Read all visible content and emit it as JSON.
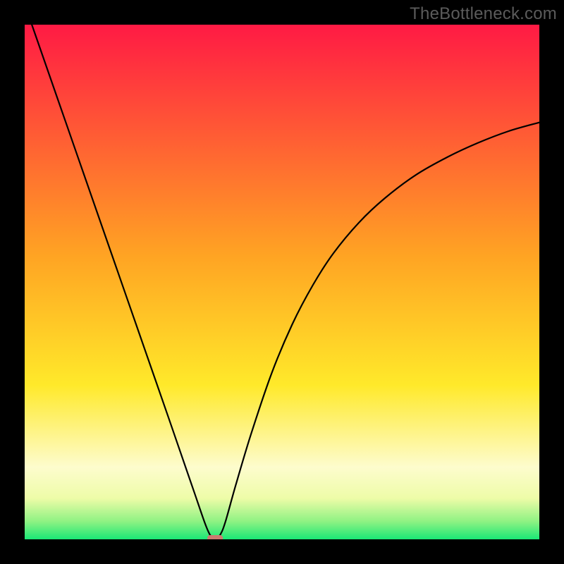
{
  "watermark": "TheBottleneck.com",
  "chart_data": {
    "type": "line",
    "title": "",
    "xlabel": "",
    "ylabel": "",
    "xlim": [
      0,
      100
    ],
    "ylim": [
      0,
      100
    ],
    "grid": false,
    "legend": false,
    "marker": {
      "x": 37,
      "y": 0,
      "color": "#cc7a70"
    },
    "gradient_stops": [
      {
        "offset": 0.0,
        "color": "#ff1a44"
      },
      {
        "offset": 0.45,
        "color": "#ffa423"
      },
      {
        "offset": 0.7,
        "color": "#ffe92a"
      },
      {
        "offset": 0.86,
        "color": "#fdfccd"
      },
      {
        "offset": 0.92,
        "color": "#eefca8"
      },
      {
        "offset": 0.965,
        "color": "#8ff283"
      },
      {
        "offset": 1.0,
        "color": "#1ae876"
      }
    ],
    "series": [
      {
        "name": "bottleneck-curve",
        "x": [
          0,
          4,
          8,
          12,
          16,
          20,
          24,
          28,
          31,
          33,
          35,
          36,
          37,
          38,
          39,
          41,
          44,
          48,
          52,
          56,
          60,
          65,
          70,
          76,
          82,
          88,
          94,
          100
        ],
        "y": [
          104,
          92.5,
          81,
          69.5,
          58,
          46.5,
          35,
          23.5,
          14.8,
          9.0,
          3.2,
          0.9,
          0.0,
          0.9,
          3.4,
          10.5,
          20.5,
          32.3,
          41.8,
          49.4,
          55.6,
          61.6,
          66.3,
          70.8,
          74.2,
          77.0,
          79.3,
          81.0
        ]
      }
    ]
  }
}
